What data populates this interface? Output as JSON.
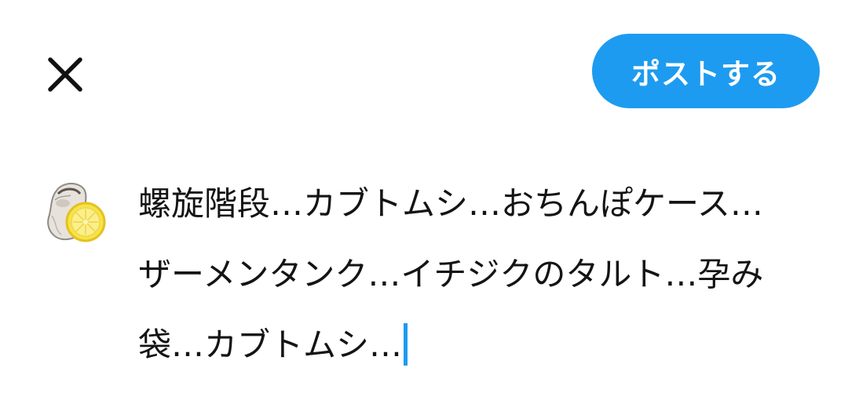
{
  "toolbar": {
    "close_icon": "close-icon",
    "post_label": "ポストする",
    "accent_color": "#1d9bf0"
  },
  "composer": {
    "avatar_icon": "oyster-lemon-avatar",
    "text": "螺旋階段…カブトムシ…おちんぽケース…ザーメンタンク…イチジクのタルト…孕み袋…カブトムシ…"
  }
}
